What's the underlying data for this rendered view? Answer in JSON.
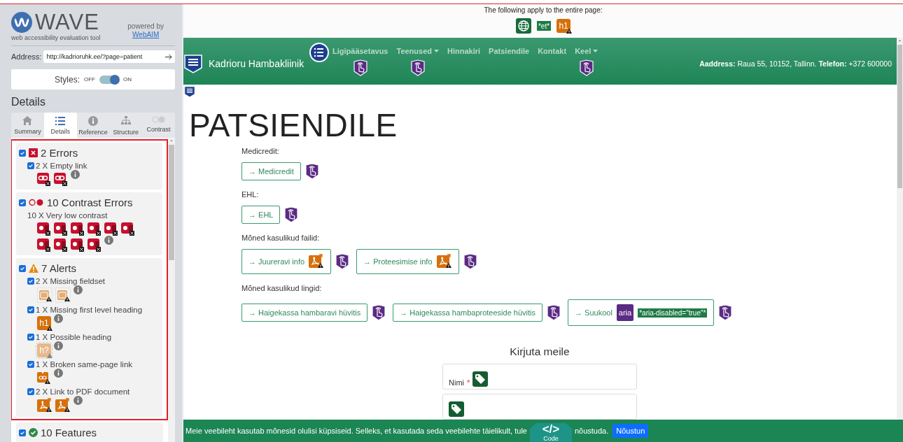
{
  "wave": {
    "title": "WAVE",
    "subtitle": "web accessibility evaluation tool",
    "powered_by": "powered by",
    "powered_link": "WebAIM",
    "address_label": "Address:",
    "address": "http://kadrioruhk.ee/?page=patient",
    "styles_label": "Styles:",
    "styles_off": "OFF",
    "styles_on": "ON",
    "styles_enabled": true,
    "details_heading": "Details",
    "tabs": [
      {
        "kind": "summary",
        "label": "Summary",
        "selected": false
      },
      {
        "kind": "details",
        "label": "Details",
        "selected": true
      },
      {
        "kind": "reference",
        "label": "Reference",
        "selected": false
      },
      {
        "kind": "structure",
        "label": "Structure",
        "selected": false
      },
      {
        "kind": "contrast",
        "label": "Contrast",
        "selected": false
      }
    ],
    "categories": [
      {
        "kind": "errors",
        "title": "2 Errors",
        "checked": true,
        "highlighted": true,
        "items": [
          {
            "kind": "check",
            "label": "2 X Empty link",
            "checked": true,
            "icons": [
              {
                "kind": "empty-link"
              },
              {
                "kind": "empty-link"
              }
            ]
          }
        ]
      },
      {
        "kind": "contrast",
        "title": "10 Contrast Errors",
        "checked": true,
        "highlighted": true,
        "items": [
          {
            "kind": "plain",
            "label": "10 X Very low contrast",
            "icons": [
              {
                "kind": "contrast"
              },
              {
                "kind": "contrast"
              },
              {
                "kind": "contrast"
              },
              {
                "kind": "contrast"
              },
              {
                "kind": "contrast"
              },
              {
                "kind": "contrast"
              },
              {
                "kind": "contrast"
              },
              {
                "kind": "contrast"
              },
              {
                "kind": "contrast"
              },
              {
                "kind": "contrast"
              }
            ]
          }
        ]
      },
      {
        "kind": "alerts",
        "title": "7 Alerts",
        "checked": true,
        "highlighted": true,
        "items": [
          {
            "kind": "check",
            "label": "2 X Missing fieldset",
            "checked": true,
            "icons": [
              {
                "kind": "fieldset"
              },
              {
                "kind": "fieldset"
              }
            ]
          },
          {
            "kind": "check",
            "label": "1 X Missing first level heading",
            "checked": true,
            "icons": [
              {
                "kind": "heading",
                "label": "h1"
              }
            ]
          },
          {
            "kind": "check",
            "label": "1 X Possible heading",
            "checked": true,
            "icons": [
              {
                "kind": "possible-heading",
                "label": "h?"
              }
            ]
          },
          {
            "kind": "check",
            "label": "1 X Broken same-page link",
            "checked": true,
            "icons": [
              {
                "kind": "broken-link"
              }
            ]
          },
          {
            "kind": "check",
            "label": "2 X Link to PDF document",
            "checked": true,
            "icons": [
              {
                "kind": "pdf"
              },
              {
                "kind": "pdf"
              }
            ]
          }
        ]
      },
      {
        "kind": "features",
        "title": "10 Features",
        "checked": true,
        "highlighted": false
      }
    ]
  },
  "page": {
    "notice": "The following apply to the entire page:",
    "page_icons": [
      {
        "kind": "language"
      },
      {
        "kind": "lang-tag",
        "label": "*et*"
      },
      {
        "kind": "heading",
        "label": "h1"
      }
    ],
    "brand_icons": [
      {
        "kind": "region"
      }
    ],
    "brand": "Kadrioru Hambakliinik",
    "nav_icons": [
      {
        "kind": "list"
      }
    ],
    "nav": [
      {
        "label": "Ligipääsetavus",
        "dropdown": false,
        "icons": [
          {
            "kind": "touch"
          }
        ]
      },
      {
        "label": "Teenused",
        "dropdown": true,
        "icons": [
          {
            "kind": "touch"
          }
        ]
      },
      {
        "label": "Hinnakiri",
        "dropdown": false
      },
      {
        "label": "Patsiendile",
        "dropdown": false
      },
      {
        "label": "Kontakt",
        "dropdown": false
      },
      {
        "label": "Keel",
        "dropdown": true,
        "icons": [
          {
            "kind": "touch"
          }
        ]
      }
    ],
    "contact": "**Aaddress:** Raua 55, 10152, Tallinn. **Telefon:** +372 600000",
    "main_icons": [
      {
        "kind": "region"
      }
    ],
    "heading": "PATSIENDILE",
    "sections": [
      {
        "label": "Medicredit:",
        "links": [
          {
            "label": "→ Medicredit",
            "outer": [
              {
                "kind": "touch"
              }
            ]
          }
        ]
      },
      {
        "label": "EHL:",
        "links": [
          {
            "label": "→ EHL",
            "outer": [
              {
                "kind": "touch"
              }
            ]
          }
        ]
      },
      {
        "label": "Mõned kasulikud failid:",
        "links": [
          {
            "label": "→ Juureravi info",
            "inner": [
              {
                "kind": "pdf"
              }
            ],
            "outer": [
              {
                "kind": "touch"
              }
            ]
          },
          {
            "label": "→ Proteesimise info",
            "inner": [
              {
                "kind": "pdf"
              }
            ],
            "outer": [
              {
                "kind": "touch"
              }
            ]
          }
        ]
      },
      {
        "label": "Mõned kasulikud lingid:",
        "links": [
          {
            "label": "→ Haigekassa hambaravi hüvitis",
            "outer": [
              {
                "kind": "touch"
              }
            ]
          },
          {
            "label": "→ Haigekassa hambaproteeside hüvitis",
            "outer": [
              {
                "kind": "touch"
              }
            ]
          },
          {
            "label": "→ Suukool",
            "inner": [
              {
                "kind": "aria",
                "label": "aria"
              },
              {
                "kind": "aria-tag",
                "label": "*aria-disabled=\"true\"*"
              }
            ],
            "outer": [
              {
                "kind": "touch"
              }
            ]
          }
        ]
      }
    ],
    "form": {
      "title": "Kirjuta meile",
      "fields": [
        {
          "label": "Nimi",
          "required_mark": "*",
          "icons": [
            {
              "kind": "tag"
            }
          ]
        },
        {
          "icons": [
            {
              "kind": "tag"
            }
          ]
        }
      ]
    },
    "cookie": {
      "text": "Meie veebileht kasutab mõnesid olulisi küpsiseid. Selleks, et kasutada seda veebilehte täielikult, tule",
      "text_end": "nõustuda.",
      "button": "Nõustun"
    },
    "code_tab": {
      "symbol": "</>",
      "label": "Code"
    }
  }
}
